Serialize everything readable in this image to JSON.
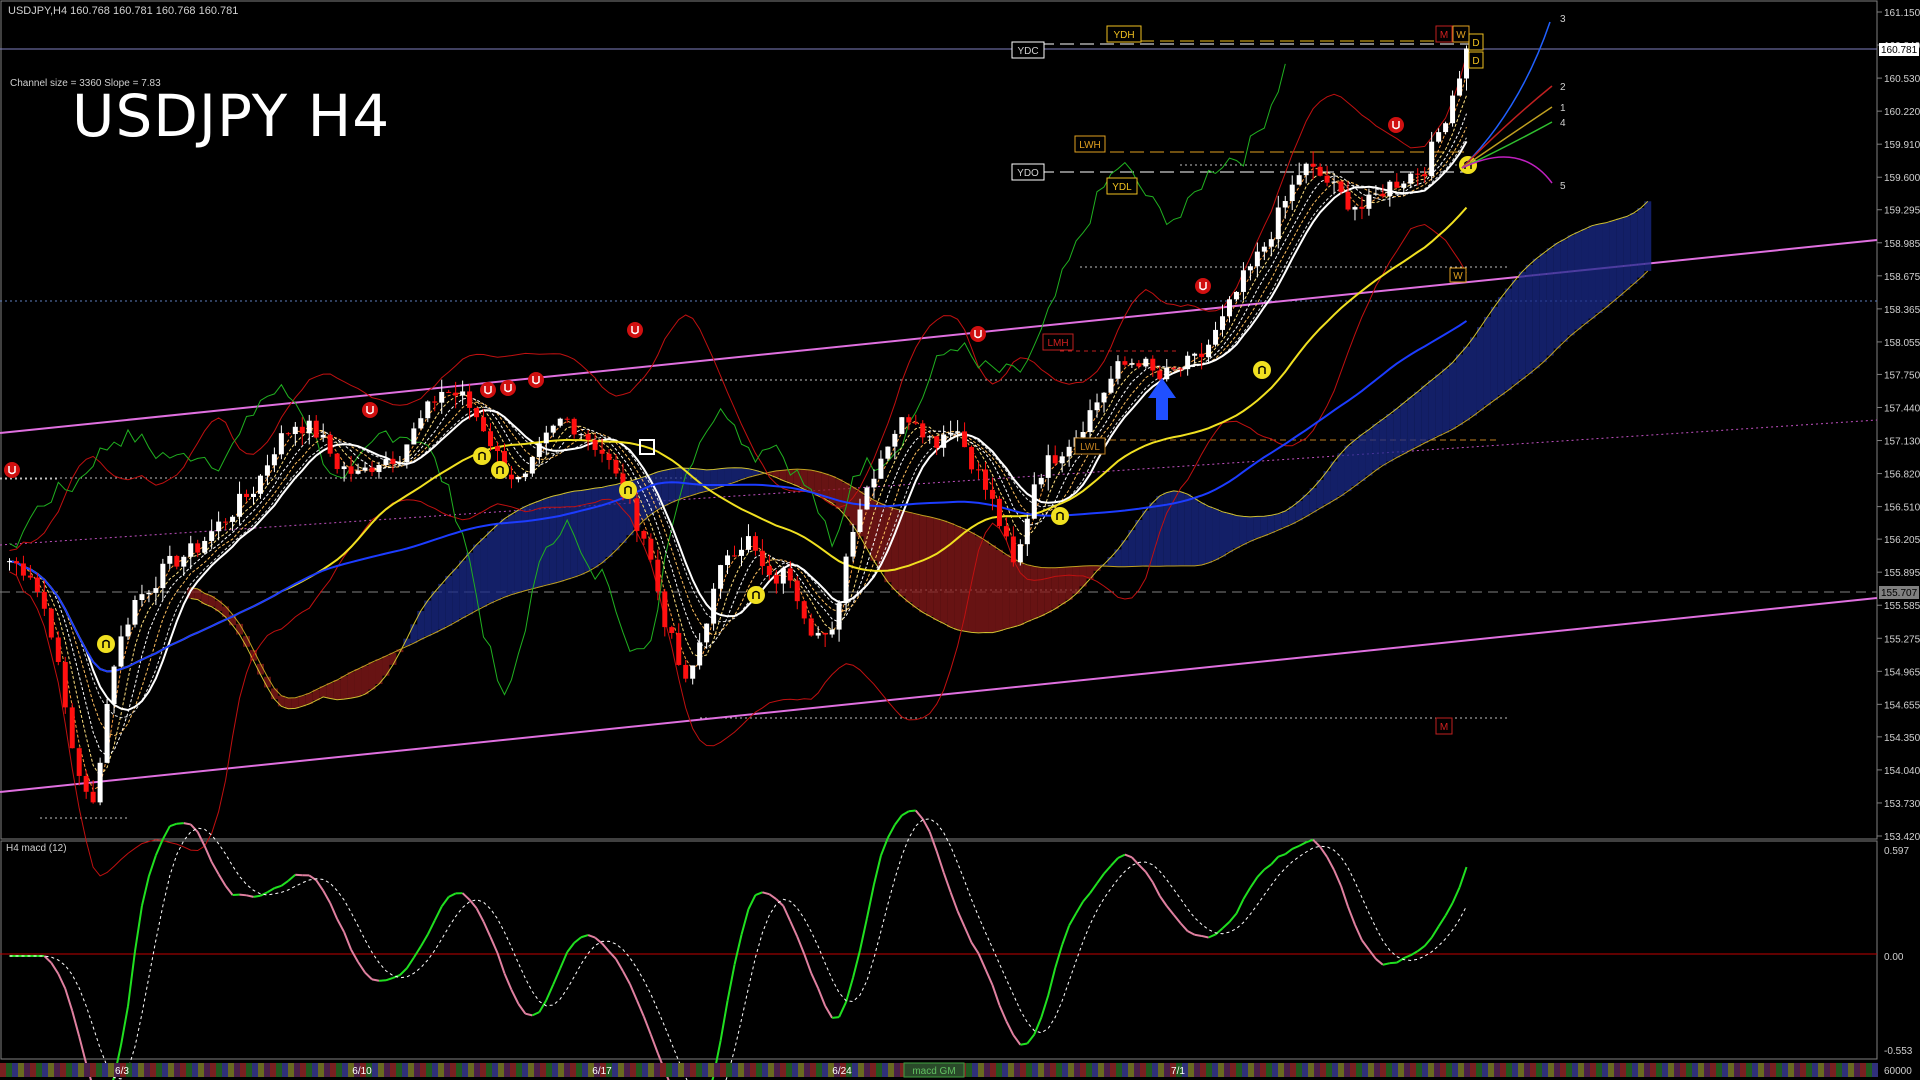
{
  "header": {
    "symbol_line": "USDJPY,H4  160.768 160.781 160.768 160.781",
    "channel_info": "Channel size = 3360 Slope = 7.83",
    "title": "USDJPY H4",
    "subwindow_label": "H4  macd (12)",
    "date_tab_label": "macd GM"
  },
  "colors": {
    "background": "#000000",
    "bull_candle": "#ffffff",
    "bear_candle": "#ff1010",
    "channel": "#e070e0",
    "ma_fast": "#ffffff",
    "ma_mid": "#f0e020",
    "ma_slow": "#1c3cff",
    "bollinger": "#c01010",
    "chikou": "#20b020",
    "cloud_bull": "#1a2a8a",
    "cloud_bear": "#8a1a1a",
    "macd_up": "#20e020",
    "macd_down": "#e080a0",
    "signal": "#ffffff",
    "zero_line": "#c00000"
  },
  "price_axis": {
    "ticks": [
      "161.150",
      "160.840",
      "160.530",
      "160.220",
      "159.910",
      "159.600",
      "159.295",
      "158.985",
      "158.675",
      "158.365",
      "158.055",
      "157.750",
      "157.440",
      "157.130",
      "156.820",
      "156.510",
      "156.205",
      "155.895",
      "155.585",
      "155.275",
      "154.965",
      "154.655",
      "154.350",
      "154.040",
      "153.730",
      "153.420"
    ],
    "current_price": "160.781",
    "marker_price": "155.707"
  },
  "macd_axis": {
    "ticks": [
      "0.597",
      "0.00",
      "-0.553",
      "60000"
    ]
  },
  "date_axis": {
    "labels": [
      "6/3",
      "6/10",
      "6/17",
      "6/24",
      "7/1"
    ]
  },
  "level_labels": {
    "ydc": "YDC",
    "ydh": "YDH",
    "ydo": "YDO",
    "ydl": "YDL",
    "lwh": "LWH",
    "lwl": "LWL",
    "lmh": "LMH",
    "m_top": "M",
    "w_top": "W",
    "d_1": "D",
    "d_2": "D",
    "m_bottom": "M",
    "w_mid": "W"
  },
  "projection_labels": [
    "3",
    "2",
    "1",
    "4",
    "5"
  ],
  "chart_data": {
    "type": "candlestick",
    "symbol": "USDJPY",
    "timeframe": "H4",
    "ylim": [
      153.42,
      161.15
    ],
    "x_dates": [
      "6/3",
      "6/10",
      "6/17",
      "6/24",
      "7/1"
    ],
    "current_price": 160.781,
    "close_path": [
      156.0,
      155.9,
      155.4,
      154.3,
      153.6,
      155.0,
      155.6,
      155.8,
      156.0,
      156.1,
      156.3,
      156.5,
      156.7,
      157.1,
      157.3,
      157.2,
      156.9,
      156.8,
      156.95,
      157.0,
      157.3,
      157.6,
      157.55,
      157.3,
      156.9,
      156.7,
      157.1,
      157.35,
      157.2,
      157.0,
      156.6,
      156.2,
      155.4,
      154.8,
      155.5,
      156.1,
      156.2,
      155.8,
      155.9,
      155.4,
      155.2,
      156.3,
      156.8,
      157.2,
      157.4,
      157.1,
      157.3,
      156.9,
      156.5,
      155.9,
      156.8,
      157.0,
      157.2,
      157.5,
      157.8,
      157.9,
      157.7,
      157.8,
      157.9,
      158.2,
      158.6,
      158.9,
      159.3,
      159.7,
      159.6,
      159.4,
      159.3,
      159.5,
      159.6,
      159.7,
      160.2,
      160.78
    ],
    "channel": {
      "upper": [
        157.15,
        159.0
      ],
      "lower": [
        153.7,
        155.7
      ]
    },
    "macd": {
      "ylim": [
        -0.553,
        0.597
      ]
    }
  }
}
